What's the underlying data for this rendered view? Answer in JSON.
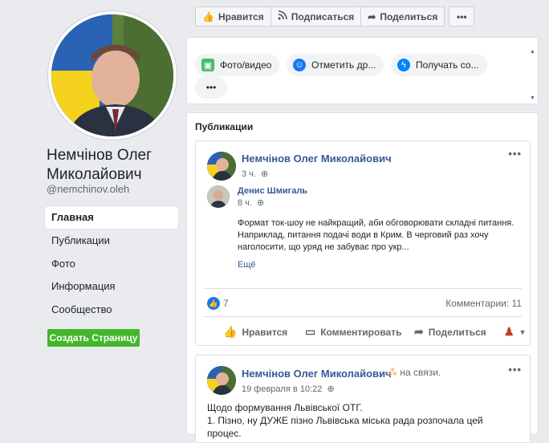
{
  "profile": {
    "name": "Немчінов Олег Миколайович",
    "handle": "@nemchinov.oleh"
  },
  "nav": {
    "items": [
      "Главная",
      "Публикации",
      "Фото",
      "Информация",
      "Сообщество"
    ],
    "create_page": "Создать Страницу"
  },
  "toolbar": {
    "like": "Нравится",
    "subscribe": "Подписаться",
    "share": "Поделиться",
    "more": "•••"
  },
  "composer": {
    "photo_video": "Фото/видео",
    "tag_friends": "Отметить др...",
    "get_messages": "Получать со...",
    "more": "•••"
  },
  "publications": {
    "title": "Публикации",
    "post1": {
      "author": "Немчінов Олег Миколайович",
      "time": "3 ч.",
      "shared_author": "Денис Шмигаль",
      "shared_time": "8 ч.",
      "text_line1": "Формат ток-шоу не найкращий, аби обговорювати складні питання.",
      "text_line2": "Наприклад, питання подачі води в Крим. В черговий раз хочу",
      "text_line3": "наголосити, що уряд не забуває про укр...",
      "more": "Ещё",
      "likes": "7",
      "comments": "Комментарии: 11",
      "like_action": "Нравится",
      "comment_action": "Комментировать",
      "share_action": "Поделиться"
    },
    "post2": {
      "author": "Немчінов Олег Миколайович",
      "status": "на связи.",
      "time": "19 февраля в 10:22",
      "line1": "Щодо формування Львівської ОТГ.",
      "line2": "1. Пізно, ну ДУЖЕ пізно Львівська міська рада розпочала цей",
      "line3": "процес."
    }
  },
  "colors": {
    "link": "#385898",
    "create_button": "#42b72a",
    "like_badge": "#1877f2"
  }
}
